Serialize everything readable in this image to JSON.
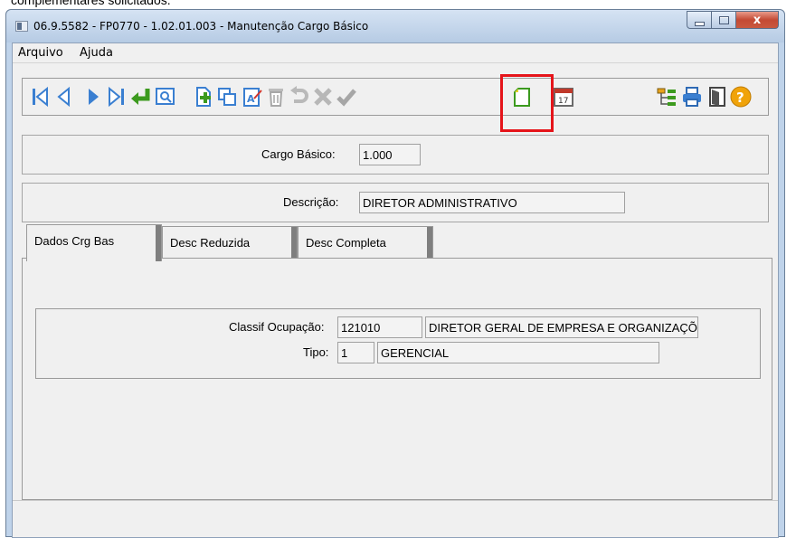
{
  "document": {
    "caption_fragment": "complementares solicitados."
  },
  "window": {
    "title": "06.9.5582 - FP0770 - 1.02.01.003 - Manutenção Cargo Básico"
  },
  "window_controls": {
    "close_glyph": "x"
  },
  "menu": {
    "items": [
      {
        "label": "Arquivo"
      },
      {
        "label": "Ajuda"
      }
    ]
  },
  "toolbar": {
    "icons": [
      "first-record-icon",
      "previous-record-icon",
      "next-record-icon",
      "last-record-icon",
      "goto-icon",
      "search-icon",
      "add-icon",
      "copy-icon",
      "edit-icon",
      "delete-icon",
      "undo-icon",
      "cancel-icon",
      "confirm-icon",
      "new-document-icon",
      "calendar-icon",
      "tree-icon",
      "print-icon",
      "exit-icon",
      "help-icon"
    ],
    "calendar_day": "17",
    "help_glyph": "?",
    "highlight_color": "#e5141a"
  },
  "form": {
    "cargo_basico": {
      "label": "Cargo Básico:",
      "value": "1.000"
    },
    "descricao": {
      "label": "Descrição:",
      "value": "DIRETOR ADMINISTRATIVO"
    }
  },
  "tabs": [
    {
      "label": "Dados Crg Bas",
      "active": true
    },
    {
      "label": "Desc Reduzida",
      "active": false
    },
    {
      "label": "Desc Completa",
      "active": false
    }
  ],
  "dados": {
    "classif_ocupacao": {
      "label": "Classif Ocupação:",
      "code": "121010",
      "description": "DIRETOR GERAL DE EMPRESA E ORGANIZAÇÕ"
    },
    "tipo": {
      "label": "Tipo:",
      "code": "1",
      "description": "GERENCIAL"
    }
  }
}
